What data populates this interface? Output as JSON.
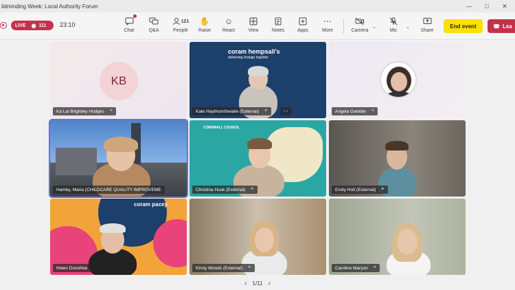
{
  "window": {
    "title": "ildminding Week: Local Authority Forum",
    "controls": [
      "minimize-icon",
      "maximize-icon",
      "close-icon"
    ]
  },
  "toolbar": {
    "live_label": "LIVE",
    "viewers": "111",
    "timer": "23:10",
    "buttons": {
      "chat": "Chat",
      "qa": "Q&A",
      "people": "People",
      "people_count": "121",
      "raise": "Raise",
      "react": "React",
      "view": "View",
      "notes": "Notes",
      "apps": "Apps",
      "more": "More",
      "camera": "Camera",
      "mic": "Mic",
      "share": "Share"
    },
    "end_event": "End event",
    "leave": "Lea"
  },
  "participants": [
    {
      "name": "Ka Lai Brightley Hodges",
      "initials": "KB"
    },
    {
      "name": "Kate Haythornthwaite (External)",
      "brand": "coram hempsall's",
      "tagline": "delivering change together"
    },
    {
      "name": "Angela Gamble"
    },
    {
      "name": "Hamby, Maria (CHILDCARE QUALITY IMPROVEME"
    },
    {
      "name": "Christina Husk (External)",
      "brand": "CORNWALL COUNCIL"
    },
    {
      "name": "Emily Holt (External)"
    },
    {
      "name": "Helen Donohoe",
      "brand": "coram pacey"
    },
    {
      "name": "Kirsty Woods (External)"
    },
    {
      "name": "Caroline Maryon"
    }
  ],
  "pager": {
    "label": "1/11"
  },
  "colors": {
    "accent_red": "#c4314b",
    "end_yellow": "#fce100",
    "hempsall_navy": "#1d3f6b",
    "cornwall_teal": "#2aa6a3",
    "pacey_pink": "#e8437a"
  }
}
